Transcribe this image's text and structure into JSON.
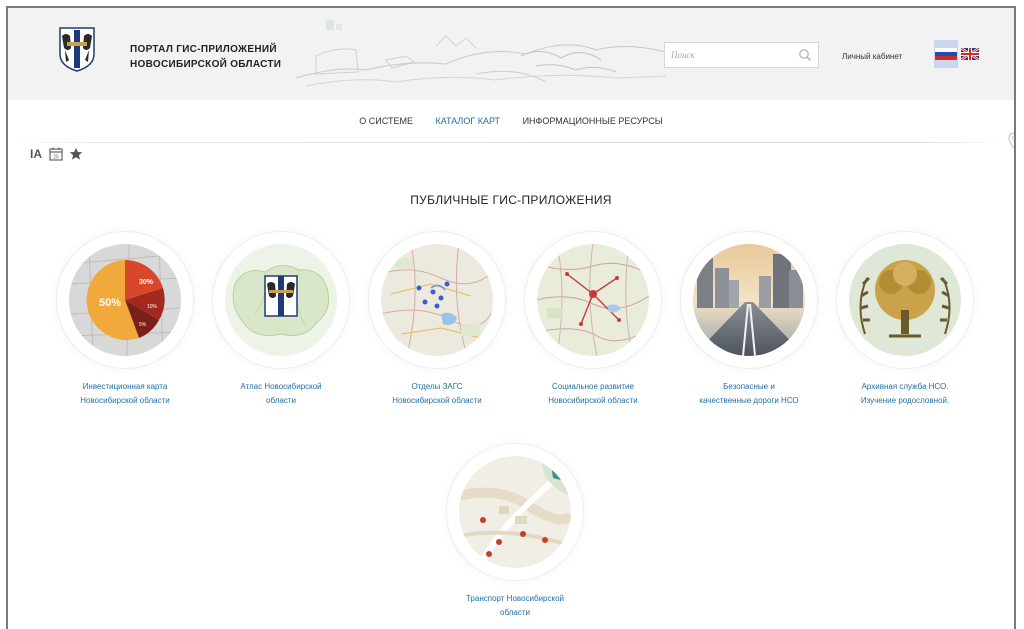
{
  "header": {
    "title_line1": "ПОРТАЛ ГИС-ПРИЛОЖЕНИЙ",
    "title_line2": "НОВОСИБИРСКОЙ ОБЛАСТИ",
    "search_placeholder": "Поиск",
    "cabinet_label": "Личный кабинет"
  },
  "nav": {
    "items": [
      {
        "label": "О СИСТЕМЕ",
        "active": false
      },
      {
        "label": "КАТАЛОГ КАРТ",
        "active": true
      },
      {
        "label": "ИНФОРМАЦИОННЫЕ РЕСУРСЫ",
        "active": false
      }
    ]
  },
  "toolbar": {
    "font_size_label": "IA",
    "calendar_day": "25"
  },
  "section_title": "ПУБЛИЧНЫЕ ГИС-ПРИЛОЖЕНИЯ",
  "apps": [
    {
      "line1": "Инвестиционная карта",
      "line2": "Новосибирской области",
      "pie_labels": [
        "50%",
        "30%",
        "10%",
        "5%"
      ]
    },
    {
      "line1": "Атлас Новосибирской",
      "line2": "области"
    },
    {
      "line1": "Отделы ЗАГС",
      "line2": "Новосибирской области"
    },
    {
      "line1": "Социальное развитие",
      "line2": "Новосибирской области"
    },
    {
      "line1": "Безопасные и",
      "line2": "качественные дороги НСО"
    },
    {
      "line1": "Архивная служба НСО.",
      "line2": "Изучение родословной."
    },
    {
      "line1": "Транспорт Новосибирской",
      "line2": "области"
    }
  ],
  "colors": {
    "link": "#1f6fa8",
    "header_bg": "#f2f2f2",
    "pie_orange": "#f0a93a",
    "pie_red": "#d9472b",
    "pie_dark": "#7a1f1a",
    "tree_gold": "#c9a24a"
  },
  "icons": [
    "coat-of-arms-icon",
    "search-icon",
    "flag-ru-icon",
    "flag-en-icon",
    "calendar-icon",
    "star-icon",
    "map-pin-icon"
  ]
}
